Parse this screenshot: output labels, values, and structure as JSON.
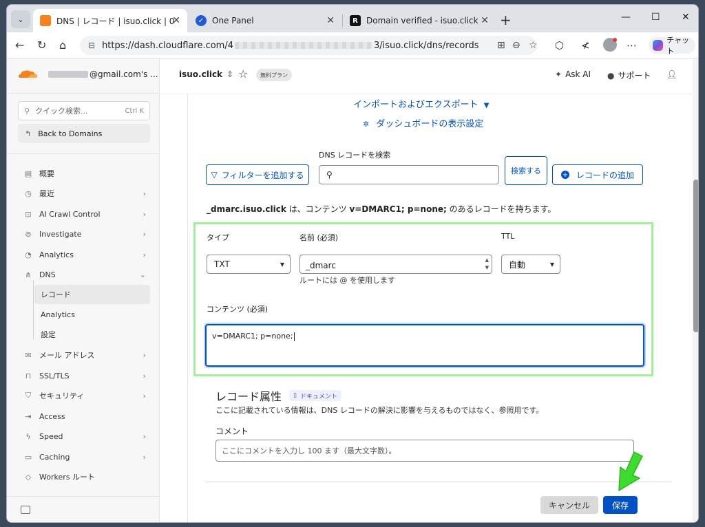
{
  "browser": {
    "tabs": [
      {
        "title": "DNS | レコード | isuo.click | 0",
        "favicon_color": "#f6821f"
      },
      {
        "title": "One Panel",
        "favicon_color": "#2459d8"
      },
      {
        "title": "Domain verified - isuo.click",
        "favicon_color": "#111111"
      }
    ],
    "url_prefix": "https://dash.cloudflare.com/4",
    "url_suffix": "3/isuo.click/dns/records",
    "chat_label": "チャット"
  },
  "sidebar": {
    "account_suffix": "@gmail.com's ...",
    "quick_search": {
      "placeholder": "クイック検索...",
      "shortcut": "Ctrl K"
    },
    "back_label": "Back to Domains",
    "items": [
      {
        "label": "概要",
        "icon": "overview-icon",
        "has_chevron": false
      },
      {
        "label": "最近",
        "icon": "clock-icon",
        "has_chevron": true
      },
      {
        "label": "AI Crawl Control",
        "icon": "robot-icon",
        "has_chevron": true
      },
      {
        "label": "Investigate",
        "icon": "investigate-icon",
        "has_chevron": true
      },
      {
        "label": "Analytics",
        "icon": "analytics-icon",
        "has_chevron": true
      },
      {
        "label": "DNS",
        "icon": "dns-icon",
        "has_chevron": true
      }
    ],
    "dns_sub": [
      {
        "label": "レコード",
        "selected": true
      },
      {
        "label": "Analytics",
        "selected": false
      },
      {
        "label": "設定",
        "selected": false
      }
    ],
    "items2": [
      {
        "label": "メール アドレス",
        "icon": "mail-icon"
      },
      {
        "label": "SSL/TLS",
        "icon": "lock-icon"
      },
      {
        "label": "セキュリティ",
        "icon": "shield-icon"
      },
      {
        "label": "Access",
        "icon": "access-icon"
      },
      {
        "label": "Speed",
        "icon": "bolt-icon"
      },
      {
        "label": "Caching",
        "icon": "cache-icon"
      },
      {
        "label": "Workers ルート",
        "icon": "workers-icon"
      }
    ]
  },
  "header": {
    "zone": "isuo.click",
    "plan": "無料プラン",
    "ask_ai": "Ask AI",
    "support": "サポート"
  },
  "main": {
    "import_export": "インポートおよびエクスポート",
    "dashboard_settings": "ダッシュボードの表示設定",
    "search_label": "DNS レコードを検索",
    "filter_btn": "フィルターを追加する",
    "search_btn": "検索する",
    "add_record_btn": "レコードの追加",
    "summary": {
      "name": "_dmarc.isuo.click",
      "mid": " は、コンテンツ ",
      "content": "v=DMARC1; p=none;",
      "end": " のあるレコードを持ちます。"
    },
    "form": {
      "type_label": "タイプ",
      "type_value": "TXT",
      "name_label": "名前 (必須)",
      "name_value": "_dmarc",
      "name_hint": "ルートには @ を使用します",
      "ttl_label": "TTL",
      "ttl_value": "自動",
      "content_label": "コンテンツ (必須)",
      "content_value": "v=DMARC1; p=none;"
    },
    "record_attr": {
      "title": "レコード属性",
      "doc_badge": "ドキュメント",
      "desc": "ここに記載されている情報は、DNS レコードの解決に影響を与えるものではなく、参照用です。",
      "comment_label": "コメント",
      "comment_placeholder": "ここにコメントを入力し 100 ます（最大文字数）。"
    },
    "cancel": "キャンセル",
    "save": "保存"
  },
  "colors": {
    "accent": "#0051c3",
    "highlight_box": "#a4ef99",
    "annotation_arrow": "#3ddc2f"
  }
}
